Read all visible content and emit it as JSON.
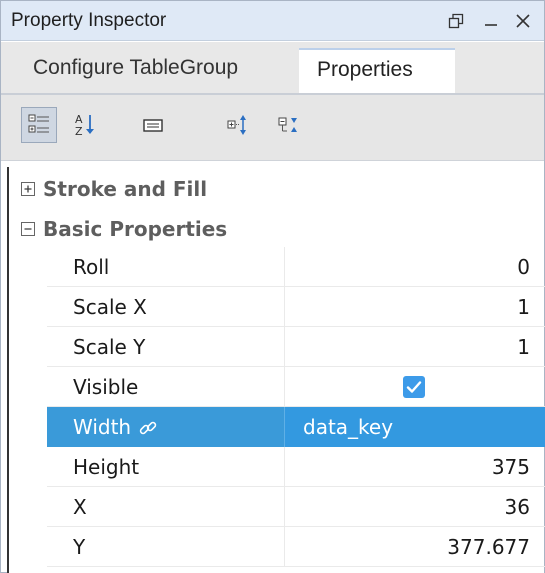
{
  "window": {
    "title": "Property Inspector"
  },
  "tabs": [
    {
      "label": "Configure TableGroup",
      "active": false
    },
    {
      "label": "Properties",
      "active": true
    }
  ],
  "toolbar": {
    "buttons": [
      {
        "icon": "categorized-view-icon",
        "active": true
      },
      {
        "icon": "sort-alphabetical-icon",
        "active": false
      },
      {
        "icon": "property-pages-icon",
        "active": false
      },
      {
        "icon": "expand-all-icon",
        "active": false
      },
      {
        "icon": "collapse-all-icon",
        "active": false
      }
    ]
  },
  "categories": [
    {
      "label": "Stroke and Fill",
      "expanded": false
    },
    {
      "label": "Basic Properties",
      "expanded": true
    }
  ],
  "properties": [
    {
      "name": "Roll",
      "value": "0"
    },
    {
      "name": "Scale X",
      "value": "1"
    },
    {
      "name": "Scale Y",
      "value": "1"
    },
    {
      "name": "Visible",
      "value": "",
      "checked": true
    },
    {
      "name": "Width",
      "value": "data_key",
      "bound": true,
      "selected": true
    },
    {
      "name": "Height",
      "value": "375"
    },
    {
      "name": "X",
      "value": "36"
    },
    {
      "name": "Y",
      "value": "377.677"
    }
  ],
  "colors": {
    "selection": "#3399e0",
    "titlebar": "#dfe9f6",
    "checkbox": "#3d9be9"
  }
}
